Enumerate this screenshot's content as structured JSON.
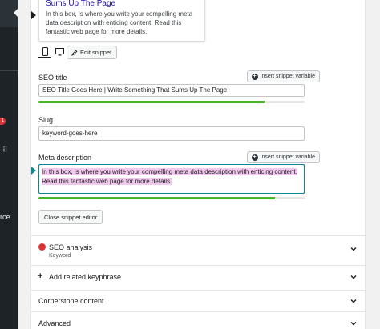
{
  "wp_sidebar": {
    "notification_count": "1",
    "truncated_label": "rce"
  },
  "snippet_preview": {
    "title": "Sums Up The Page",
    "description": "In this box, is where you write your compelling meta data description with enticing content. Read this fantastic web page for more details."
  },
  "snippet_toolbar": {
    "edit_label": "Edit snippet",
    "mobile_icon": "mobile-icon",
    "desktop_icon": "desktop-icon",
    "pencil_icon": "pencil-icon"
  },
  "seo_title": {
    "label": "SEO title",
    "insert_variable": "Insert snippet variable",
    "value": "SEO Title Goes Here | Write Something That Sums Up The Page",
    "progress": 0.85,
    "progress_color": "#47b528"
  },
  "slug": {
    "label": "Slug",
    "value": "keyword-goes-here"
  },
  "meta_description": {
    "label": "Meta description",
    "insert_variable": "Insert snippet variable",
    "value": "In this box, is where you write your compelling meta data description with enticing content. Read this fantastic web page for more details.",
    "highlight_color": "#f2c8ef",
    "progress": 0.89,
    "progress_color": "#47b528"
  },
  "close_editor_label": "Close snippet editor",
  "sections": {
    "seo_analysis": {
      "label": "SEO analysis",
      "sublabel": "Keyword",
      "status_color": "#dc3232"
    },
    "related_keyphrase": {
      "label": "Add related keyphrase"
    },
    "cornerstone": {
      "label": "Cornerstone content"
    },
    "advanced": {
      "label": "Advanced"
    }
  }
}
